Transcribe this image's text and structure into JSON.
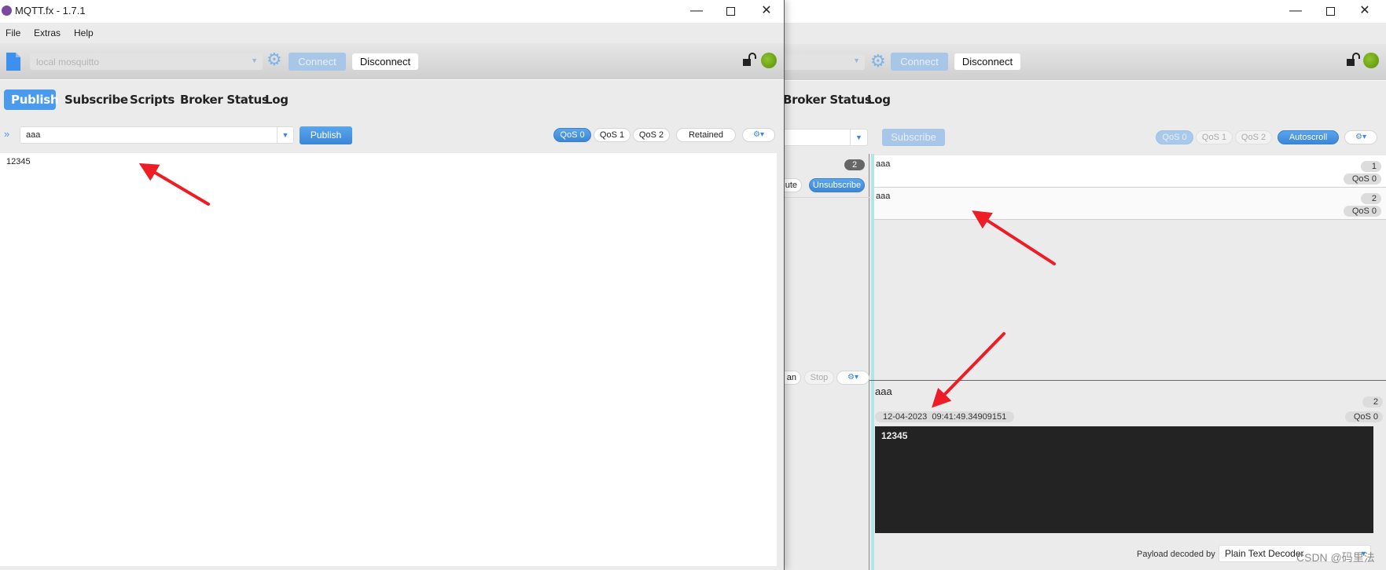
{
  "left_window": {
    "title": "MQTT.fx - 1.7.1",
    "menu": [
      "File",
      "Extras",
      "Help"
    ],
    "toolbar": {
      "profile_placeholder": "local mosquitto",
      "connect_label": "Connect",
      "disconnect_label": "Disconnect"
    },
    "tabs": [
      "Publish",
      "Subscribe",
      "Scripts",
      "Broker Status",
      "Log"
    ],
    "active_tab": "Publish",
    "publish": {
      "topic_value": "aaa",
      "publish_label": "Publish",
      "qos": [
        "QoS 0",
        "QoS 1",
        "QoS 2"
      ],
      "selected_qos": "QoS 0",
      "retained_label": "Retained",
      "payload": "12345"
    }
  },
  "right_window": {
    "toolbar": {
      "connect_label": "Connect",
      "disconnect_label": "Disconnect"
    },
    "tabs_visible": [
      "Broker Status",
      "Log"
    ],
    "subscribe": {
      "subscribe_label": "Subscribe",
      "qos": [
        "QoS 0",
        "QoS 1",
        "QoS 2"
      ],
      "autoscroll_label": "Autoscroll",
      "subscription_count": "2",
      "mute_label": "ute",
      "unsubscribe_label": "Unsubscribe",
      "scan_label": "an",
      "stop_label": "Stop"
    },
    "messages": [
      {
        "topic": "aaa",
        "number": "1",
        "qos": "QoS 0"
      },
      {
        "topic": "aaa",
        "number": "2",
        "qos": "QoS 0"
      }
    ],
    "detail": {
      "topic": "aaa",
      "number": "2",
      "timestamp": "12-04-2023  09:41:49.34909151",
      "qos": "QoS 0",
      "payload": "12345",
      "decoded_by_label": "Payload decoded by",
      "decoder": "Plain Text Decoder"
    }
  },
  "watermark": "CSDN @码里法",
  "colors": {
    "accent_blue": "#3b86d6",
    "status_green": "#6aa512",
    "annotation_red": "#ee1c24",
    "selection_teal": "#b2e5e4"
  }
}
